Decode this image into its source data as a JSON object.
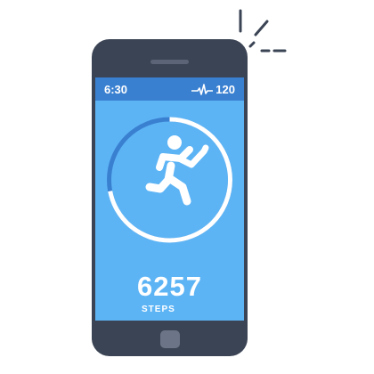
{
  "status_bar": {
    "time": "6:30",
    "heart_rate": "120",
    "heart_icon": "pulse-icon"
  },
  "tracker": {
    "activity_icon": "running-person-icon",
    "progress": 0.72,
    "steps_value": "6257",
    "steps_label": "STEPS"
  },
  "colors": {
    "phone_body": "#3b4454",
    "screen": "#5db4f5",
    "status_bar": "#3a80d1",
    "ring_track": "#3a80d1",
    "ring_progress": "#ffffff"
  }
}
